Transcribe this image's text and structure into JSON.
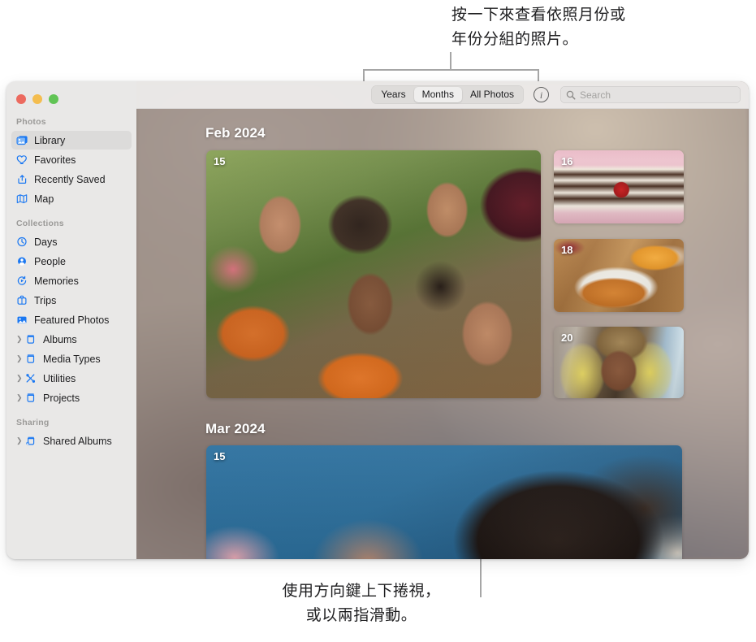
{
  "callouts": {
    "top": "按一下來查看依照月份或\n年份分組的照片。",
    "bottom": "使用方向鍵上下捲視，\n或以兩指滑動。"
  },
  "window": {
    "traffic_lights": [
      "close",
      "minimize",
      "zoom"
    ]
  },
  "sidebar": {
    "groups": [
      {
        "title": "Photos",
        "items": [
          {
            "label": "Library",
            "icon": "photos-library-icon",
            "selected": true,
            "disclosure": false
          },
          {
            "label": "Favorites",
            "icon": "heart-icon",
            "selected": false,
            "disclosure": false
          },
          {
            "label": "Recently Saved",
            "icon": "save-arrow-icon",
            "selected": false,
            "disclosure": false
          },
          {
            "label": "Map",
            "icon": "map-icon",
            "selected": false,
            "disclosure": false
          }
        ]
      },
      {
        "title": "Collections",
        "items": [
          {
            "label": "Days",
            "icon": "clock-icon",
            "selected": false,
            "disclosure": false
          },
          {
            "label": "People",
            "icon": "person-icon",
            "selected": false,
            "disclosure": false
          },
          {
            "label": "Memories",
            "icon": "memories-icon",
            "selected": false,
            "disclosure": false
          },
          {
            "label": "Trips",
            "icon": "suitcase-icon",
            "selected": false,
            "disclosure": false
          },
          {
            "label": "Featured Photos",
            "icon": "picture-icon",
            "selected": false,
            "disclosure": false
          },
          {
            "label": "Albums",
            "icon": "album-icon",
            "selected": false,
            "disclosure": true
          },
          {
            "label": "Media Types",
            "icon": "album-icon",
            "selected": false,
            "disclosure": true
          },
          {
            "label": "Utilities",
            "icon": "tools-icon",
            "selected": false,
            "disclosure": true
          },
          {
            "label": "Projects",
            "icon": "album-icon",
            "selected": false,
            "disclosure": true
          }
        ]
      },
      {
        "title": "Sharing",
        "items": [
          {
            "label": "Shared Albums",
            "icon": "shared-album-icon",
            "selected": false,
            "disclosure": true
          }
        ]
      }
    ]
  },
  "toolbar": {
    "segments": [
      {
        "label": "Years",
        "active": false
      },
      {
        "label": "Months",
        "active": true
      },
      {
        "label": "All Photos",
        "active": false
      }
    ],
    "info_button": "ⓘ",
    "search": {
      "placeholder": "Search",
      "value": ""
    }
  },
  "library": {
    "sections": [
      {
        "title": "Feb 2024",
        "photos": [
          {
            "badge": "15",
            "art": "art-selfie",
            "desc": "group-selfie"
          },
          {
            "badge": "16",
            "art": "art-cake",
            "desc": "cake-slice-with-cherry"
          },
          {
            "badge": "18",
            "art": "art-food",
            "desc": "plated-carrots-and-oranges"
          },
          {
            "badge": "20",
            "art": "art-portrait",
            "desc": "portrait-with-yellow-veil"
          }
        ]
      },
      {
        "title": "Mar 2024",
        "photos": [
          {
            "badge": "15",
            "art": "art-blue",
            "desc": "curly-hair-portrait-blue-background"
          }
        ]
      }
    ]
  },
  "colors": {
    "accent": "#1b78f2",
    "sidebar_bg": "#e9e8e7",
    "selected_row": "#dcdbda",
    "traffic_red": "#ec6a5f",
    "traffic_yellow": "#f4bd4f",
    "traffic_green": "#61c455",
    "leader_line": "#a6a6a6"
  }
}
